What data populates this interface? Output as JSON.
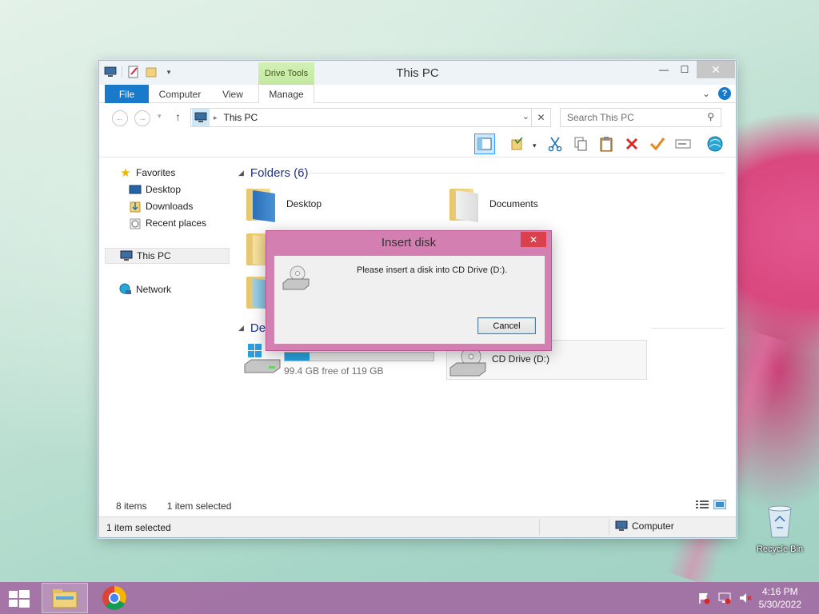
{
  "window": {
    "title": "This PC",
    "contextual_tab": "Drive Tools",
    "tabs": [
      "File",
      "Computer",
      "View",
      "Manage"
    ],
    "minimize_glyph": "—",
    "maximize_glyph": "☐",
    "close_glyph": "✕",
    "help_glyph": "?",
    "collapse_glyph": "⌄"
  },
  "address": {
    "crumb": "This PC",
    "search_placeholder": "Search This PC",
    "back_glyph": "←",
    "forward_glyph": "→",
    "recent_glyph": "▾",
    "up_glyph": "↑",
    "dropdown_glyph": "⌄",
    "clear_glyph": "✕",
    "search_glyph": "⚲"
  },
  "nav": {
    "favorites": "Favorites",
    "desktop": "Desktop",
    "downloads": "Downloads",
    "recent": "Recent places",
    "thispc": "This PC",
    "network": "Network"
  },
  "content": {
    "folders_header": "Folders (6)",
    "devices_header": "Dev",
    "folders": [
      "Desktop",
      "Documents"
    ],
    "drive_c_free": "99.4 GB free of 119 GB",
    "drive_c_used_fraction": 0.165,
    "drive_d_label": "CD Drive (D:)"
  },
  "status": {
    "items": "8 items",
    "selected": "1 item selected",
    "bottom_left": "1 item selected",
    "location": "Computer"
  },
  "dialog": {
    "title": "Insert disk",
    "message": "Please insert a disk into CD Drive (D:).",
    "cancel": "Cancel",
    "close_glyph": "✕"
  },
  "desktop": {
    "recycle_bin": "Recycle Bin"
  },
  "taskbar": {
    "time": "4:16 PM",
    "date": "5/30/2022"
  },
  "colors": {
    "accent": "#1979ca",
    "progress": "#26a0da",
    "dialog_frame": "#d47fb1",
    "taskbar": "#a264a0"
  }
}
